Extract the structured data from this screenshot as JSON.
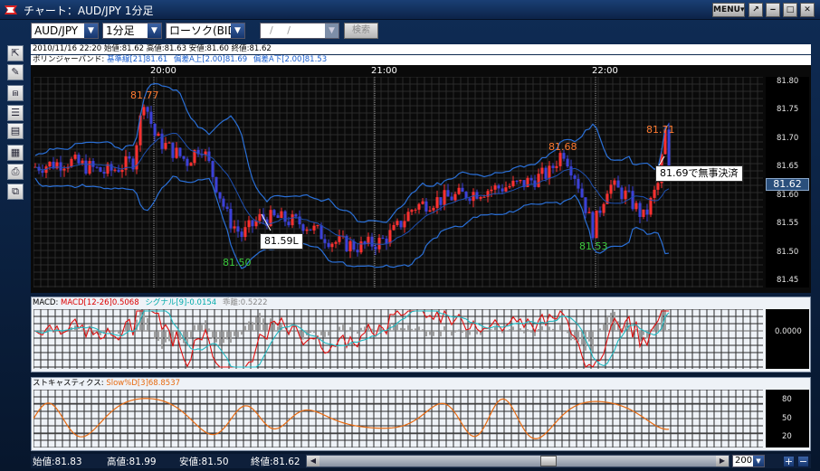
{
  "window": {
    "title": "チャート：AUD/JPY 1分足",
    "menu_label": "MENU▾",
    "controls": [
      "↗",
      "‒",
      "□",
      "✕"
    ]
  },
  "toolbar": {
    "pair": "AUD/JPY",
    "timeframe": "1分足",
    "chart_type": "ローソク(BID)",
    "date_placeholder": "/  /",
    "search_label": "検索"
  },
  "tools": [
    "⇱",
    "✎",
    "⩎",
    "☰",
    "▤",
    "▦",
    "⎙",
    "⧉"
  ],
  "tool_names": [
    "cursor-tool-icon",
    "pencil-tool-icon",
    "indicator-tool-icon",
    "numbers-tool-icon",
    "table-tool-icon",
    "list-tool-icon",
    "print-tool-icon",
    "window-tool-icon"
  ],
  "price_info": "2010/11/16 22:20  始値:81.62  高値:81.63  安値:81.60  終値:81.62",
  "bollinger_info": {
    "label": "ボリンジャーバンド:",
    "mid": "基準線[21]81.61",
    "upper": "偏差A上[2.00]81.69",
    "lower": "偏差A下[2.00]81.53"
  },
  "colors": {
    "bull": "#ff3030",
    "bear": "#3b40d8",
    "band": "#2a6fd6",
    "macd": "#e01010",
    "signal": "#20b8c0",
    "hist": "#a0a0a0",
    "stoch": "#e86a10",
    "peak": "#ff7a30",
    "low": "#3cc83c"
  },
  "main_chart": {
    "x_labels": [
      "20:00",
      "21:00",
      "22:00"
    ],
    "y_ticks": [
      "81.80",
      "81.75",
      "81.70",
      "81.65",
      "81.60",
      "81.55",
      "81.50",
      "81.45"
    ],
    "current_price": "81.62",
    "annotations": {
      "high1": "81.77",
      "low1": "81.50",
      "high2": "81.68",
      "low2": "81.53",
      "high3": "81.71"
    },
    "callout_entry": "81.59L",
    "callout_exit": "81.69で無事決済"
  },
  "macd_panel": {
    "label": "MACD:",
    "macd": "MACD[12-26]0.5068",
    "signal": "シグナル[9]-0.0154",
    "diff": "乖離:0.5222",
    "zero_tick": "0.0000"
  },
  "stoch_panel": {
    "label": "ストキャスティクス:",
    "value": "Slow%D[3]68.8537",
    "y_ticks": [
      "80",
      "50",
      "20"
    ]
  },
  "bottom": {
    "open": "始値:81.83",
    "high": "高値:81.99",
    "low": "安値:81.50",
    "close": "終値:81.62",
    "zoom": "200"
  }
}
